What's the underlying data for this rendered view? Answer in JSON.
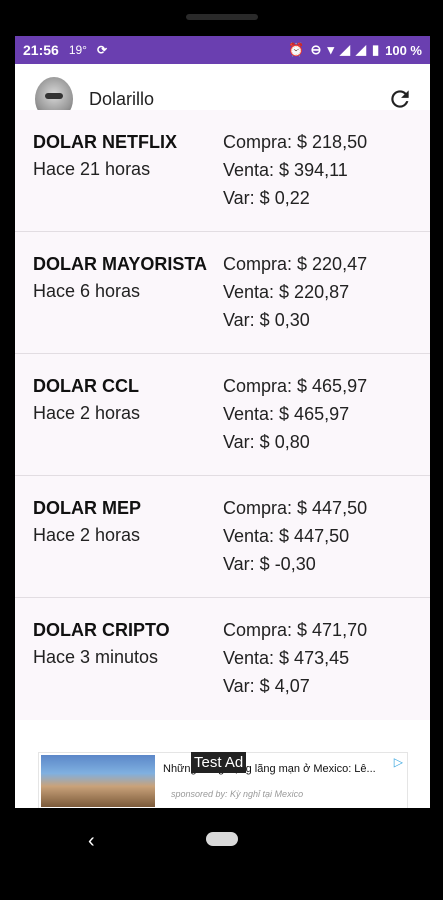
{
  "status_bar": {
    "time": "21:56",
    "temperature": "19°",
    "battery": "100 %"
  },
  "app_bar": {
    "title": "Dolarillo"
  },
  "items": [
    {
      "name": "DOLAR NETFLIX",
      "time": "Hace 21 horas",
      "compra": "Compra: $ 218,50",
      "venta": "Venta: $ 394,11",
      "var": "Var: $ 0,22"
    },
    {
      "name": "DOLAR MAYORISTA",
      "time": "Hace 6 horas",
      "compra": "Compra: $ 220,47",
      "venta": "Venta: $ 220,87",
      "var": "Var: $ 0,30"
    },
    {
      "name": "DOLAR CCL",
      "time": "Hace 2 horas",
      "compra": "Compra: $ 465,97",
      "venta": "Venta: $ 465,97",
      "var": "Var: $ 0,80"
    },
    {
      "name": "DOLAR MEP",
      "time": "Hace 2 horas",
      "compra": "Compra: $ 447,50",
      "venta": "Venta: $ 447,50",
      "var": "Var: $ -0,30"
    },
    {
      "name": "DOLAR CRIPTO",
      "time": "Hace 3 minutos",
      "compra": "Compra: $ 471,70",
      "venta": "Venta: $ 473,45",
      "var": "Var: $ 4,07"
    }
  ],
  "ad": {
    "label": "Test Ad",
    "headline": "Những hang động lãng mạn ở Mexico: Lê...",
    "sponsor": "sponsored by: Kỳ nghỉ tại Mexico"
  },
  "nav": {
    "back": "‹"
  }
}
